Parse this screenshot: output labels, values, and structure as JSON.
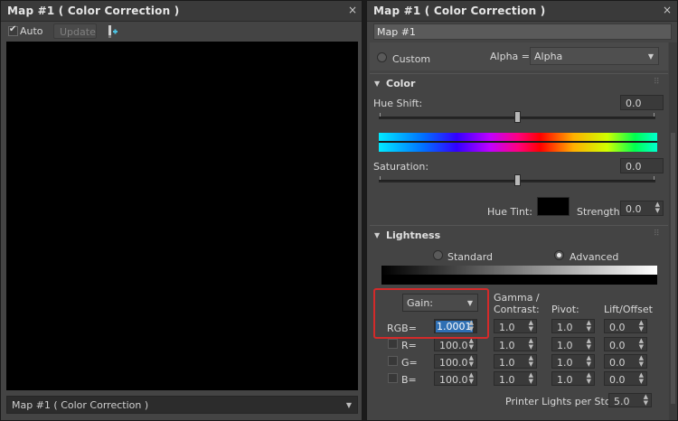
{
  "left_window": {
    "title": "Map #1  ( Color Correction )",
    "close_label": "×",
    "auto_label": "Auto",
    "update_label": "Update",
    "footer_dropdown_value": "Map #1  ( Color Correction )"
  },
  "right_window": {
    "title": "Map #1  ( Color Correction )",
    "close_label": "×",
    "map_name": "Map #1",
    "custom_label": "Custom",
    "alpha_label": "Alpha =",
    "alpha_value": "Alpha",
    "color_section": {
      "title": "Color",
      "hue_shift_label": "Hue Shift:",
      "hue_shift_value": "0.0",
      "saturation_label": "Saturation:",
      "saturation_value": "0.0",
      "hue_tint_label": "Hue Tint:",
      "strength_label": "Strength:",
      "strength_value": "0.0"
    },
    "lightness_section": {
      "title": "Lightness",
      "standard_label": "Standard",
      "advanced_label": "Advanced",
      "gain_value": "Gain:",
      "gamma_label": "Gamma /\nContrast:",
      "pivot_label": "Pivot:",
      "lift_label": "Lift/Offset",
      "rows": [
        {
          "label": "RGB=",
          "gain": "1.0001",
          "gamma": "1.0",
          "pivot": "1.0",
          "lift": "0.0"
        },
        {
          "label": "R=",
          "gain": "100.0",
          "gamma": "1.0",
          "pivot": "1.0",
          "lift": "0.0"
        },
        {
          "label": "G=",
          "gain": "100.0",
          "gamma": "1.0",
          "pivot": "1.0",
          "lift": "0.0"
        },
        {
          "label": "B=",
          "gain": "100.0",
          "gamma": "1.0",
          "pivot": "1.0",
          "lift": "0.0"
        }
      ],
      "printer_lights_label": "Printer Lights per Stop",
      "printer_lights_value": "5.0"
    },
    "colors": {
      "highlight_box": "#d42a2a",
      "selection": "#2f6fb3"
    }
  }
}
